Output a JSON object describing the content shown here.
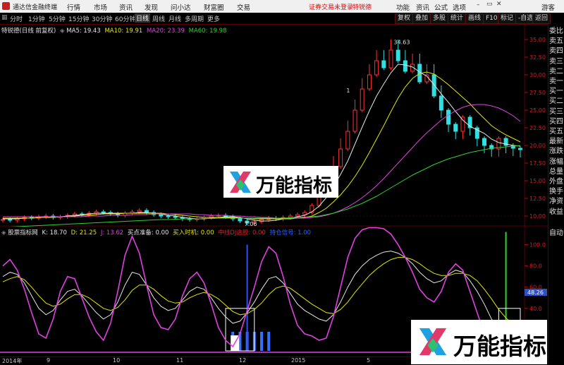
{
  "titlebar": {
    "app_name": "通达信金融终端",
    "menus": [
      "行情",
      "市场",
      "资讯",
      "发现",
      "问小达",
      "财富圈",
      "交易"
    ],
    "notice": "证券交易未登录",
    "tag": "特锐德",
    "buttons": [
      "功能",
      "资讯",
      "公式",
      "选项"
    ],
    "user": "游客",
    "colors": {
      "bg": "#f0f0f0",
      "notice": "#d01010"
    }
  },
  "toolbar": {
    "timeframes": [
      "分时",
      "1分钟",
      "5分钟",
      "15分钟",
      "30分钟",
      "60分钟",
      "日线",
      "周线",
      "月线",
      "多周期",
      "更多"
    ],
    "active_timeframe": "日线",
    "right_buttons": [
      "复权",
      "叠加",
      "多股",
      "统计",
      "画线",
      "F10",
      "标记",
      "-自选",
      "返回"
    ]
  },
  "price_panel": {
    "stock_label": "特锐德(日线 前复权)",
    "ma_legend": [
      {
        "label": "MA5: 19.43",
        "color": "#e6e6e6"
      },
      {
        "label": "MA10: 19.91",
        "color": "#e6e600"
      },
      {
        "label": "MA20: 23.39",
        "color": "#e040e0"
      },
      {
        "label": "MA60: 19.98",
        "color": "#30d030"
      }
    ],
    "y_ticks": [
      "35.00",
      "32.50",
      "30.00",
      "27.50",
      "25.00",
      "22.50",
      "20.00",
      "17.50",
      "15.00",
      "12.50",
      "10.00"
    ],
    "high_label": "34.63",
    "low_label": "7.06",
    "marker_label": "1"
  },
  "indicator_panel": {
    "name_label": "股票指标网",
    "legend": [
      {
        "label": "K: 18.70",
        "color": "#e6e6e6"
      },
      {
        "label": "D: 21.25",
        "color": "#e6e600"
      },
      {
        "label": "J: 13.62",
        "color": "#e040e0"
      },
      {
        "label": "买点准备: 0.00",
        "color": "#e6e6e6"
      },
      {
        "label": "买入时机: 0.00",
        "color": "#e6e600"
      },
      {
        "label": "中线DJ选股: 0.00",
        "color": "#e02020"
      },
      {
        "label": "持仓信号: 1.00",
        "color": "#3060ff"
      }
    ],
    "y_ticks": [
      "100.0",
      "80.0",
      "60.0",
      "40.0",
      "20.0",
      "0.00"
    ],
    "current_value": "48.26"
  },
  "right_column": {
    "items": [
      "委比",
      "卖五",
      "卖四",
      "卖三",
      "卖二",
      "卖一",
      "买一",
      "买二",
      "买三",
      "买四",
      "买五",
      "最新",
      "涨跌",
      "涨幅",
      "总量",
      "外盘",
      "换手",
      "净资",
      "收益"
    ],
    "bottom_item": "自动"
  },
  "x_axis": {
    "labels": [
      "2014年",
      "9",
      "10",
      "11",
      "12",
      "2015",
      "",
      "5"
    ]
  },
  "watermarks": [
    {
      "text": "万能指标"
    },
    {
      "text": "万能指标"
    }
  ],
  "chart_data": [
    {
      "type": "candlestick",
      "title": "特锐德(日线 前复权)",
      "ylim": [
        9.0,
        36.0
      ],
      "y_ticks": [
        35.0,
        32.5,
        30.0,
        27.5,
        25.0,
        22.5,
        20.0,
        17.5,
        15.0,
        12.5,
        10.0
      ],
      "high_annotation": 34.63,
      "low_annotation": 7.06,
      "close_series": [
        9.5,
        9.4,
        9.6,
        9.8,
        9.7,
        9.9,
        10.0,
        9.8,
        9.9,
        10.1,
        10.3,
        10.2,
        10.4,
        10.6,
        10.5,
        10.3,
        10.1,
        10.4,
        10.6,
        10.8,
        10.5,
        10.2,
        10.0,
        9.9,
        9.8,
        9.6,
        9.5,
        9.6,
        9.8,
        10.0,
        10.1,
        9.9,
        9.6,
        9.3,
        9.0,
        9.2,
        9.5,
        9.7,
        9.6,
        9.8,
        10.0,
        10.2,
        10.5,
        11.5,
        13.0,
        14.8,
        17.0,
        19.5,
        22.0,
        25.0,
        28.0,
        30.0,
        32.0,
        31.0,
        33.5,
        32.0,
        30.5,
        31.5,
        29.0,
        30.0,
        27.0,
        25.0,
        23.0,
        22.0,
        24.0,
        22.5,
        21.0,
        20.0,
        19.5,
        21.0,
        20.0,
        19.6,
        19.4
      ],
      "series": [
        {
          "name": "MA5",
          "values": [
            9.6,
            9.6,
            9.6,
            9.7,
            9.7,
            9.8,
            9.8,
            9.8,
            9.9,
            10.0,
            10.1,
            10.2,
            10.3,
            10.4,
            10.4,
            10.4,
            10.4,
            10.4,
            10.4,
            10.5,
            10.5,
            10.4,
            10.3,
            10.1,
            10.0,
            9.8,
            9.7,
            9.6,
            9.6,
            9.7,
            9.8,
            9.9,
            9.9,
            9.8,
            9.6,
            9.4,
            9.3,
            9.3,
            9.4,
            9.6,
            9.7,
            9.9,
            10.1,
            10.6,
            11.4,
            12.6,
            14.1,
            15.9,
            17.8,
            20.2,
            22.6,
            24.9,
            27.0,
            28.7,
            30.3,
            31.5,
            31.4,
            31.1,
            30.4,
            29.8,
            28.6,
            27.3,
            26.1,
            24.8,
            23.6,
            22.7,
            22.2,
            21.7,
            20.9,
            20.4,
            20.2,
            20.0,
            19.9
          ]
        },
        {
          "name": "MA10",
          "values": [
            9.7,
            9.7,
            9.7,
            9.7,
            9.7,
            9.8,
            9.8,
            9.8,
            9.9,
            9.9,
            10.0,
            10.1,
            10.1,
            10.2,
            10.3,
            10.3,
            10.3,
            10.4,
            10.4,
            10.4,
            10.4,
            10.4,
            10.4,
            10.3,
            10.2,
            10.1,
            10.0,
            9.9,
            9.8,
            9.8,
            9.8,
            9.8,
            9.8,
            9.7,
            9.7,
            9.6,
            9.6,
            9.6,
            9.6,
            9.6,
            9.6,
            9.7,
            9.8,
            10.0,
            10.5,
            11.1,
            12.0,
            13.0,
            14.2,
            15.6,
            17.2,
            19.0,
            20.9,
            22.8,
            24.8,
            26.7,
            28.3,
            29.5,
            30.2,
            30.4,
            30.1,
            29.4,
            28.6,
            27.7,
            26.8,
            25.9,
            24.8,
            23.8,
            22.8,
            22.1,
            21.5,
            21.0,
            20.5
          ]
        },
        {
          "name": "MA20",
          "values": [
            9.9,
            9.9,
            9.9,
            9.9,
            9.9,
            9.9,
            9.9,
            9.9,
            9.9,
            9.9,
            9.9,
            9.9,
            10.0,
            10.0,
            10.0,
            10.1,
            10.1,
            10.1,
            10.2,
            10.2,
            10.2,
            10.3,
            10.3,
            10.3,
            10.3,
            10.3,
            10.3,
            10.2,
            10.2,
            10.1,
            10.1,
            10.1,
            10.0,
            10.0,
            9.9,
            9.9,
            9.8,
            9.8,
            9.7,
            9.7,
            9.7,
            9.7,
            9.7,
            9.8,
            9.9,
            10.1,
            10.4,
            10.8,
            11.3,
            11.9,
            12.6,
            13.4,
            14.3,
            15.3,
            16.4,
            17.5,
            18.6,
            19.7,
            20.8,
            21.8,
            22.7,
            23.6,
            24.3,
            24.9,
            25.4,
            25.7,
            25.8,
            25.8,
            25.6,
            25.3,
            24.8,
            24.2,
            23.4
          ]
        },
        {
          "name": "MA60",
          "values": [
            8.4,
            8.45,
            8.5,
            8.55,
            8.6,
            8.65,
            8.7,
            8.75,
            8.8,
            8.85,
            8.9,
            8.95,
            9.0,
            9.05,
            9.1,
            9.15,
            9.2,
            9.25,
            9.3,
            9.35,
            9.4,
            9.45,
            9.5,
            9.5,
            9.55,
            9.6,
            9.6,
            9.6,
            9.65,
            9.65,
            9.7,
            9.7,
            9.7,
            9.7,
            9.7,
            9.7,
            9.7,
            9.7,
            9.7,
            9.7,
            9.75,
            9.8,
            9.85,
            9.9,
            10.0,
            10.2,
            10.4,
            10.7,
            11.0,
            11.4,
            11.8,
            12.3,
            12.8,
            13.4,
            14.0,
            14.6,
            15.2,
            15.8,
            16.3,
            16.8,
            17.3,
            17.7,
            18.1,
            18.4,
            18.7,
            19.0,
            19.2,
            19.4,
            19.6,
            19.7,
            19.8,
            19.9,
            19.98
          ]
        }
      ]
    },
    {
      "type": "line",
      "title": "股票指标网",
      "ylim": [
        0,
        105
      ],
      "y_ticks": [
        100,
        80,
        60,
        40,
        20,
        0
      ],
      "series": [
        {
          "name": "K",
          "values": [
            70,
            74,
            72,
            64,
            52,
            40,
            34,
            38,
            48,
            56,
            58,
            52,
            44,
            36,
            30,
            34,
            46,
            62,
            74,
            72,
            62,
            50,
            42,
            38,
            40,
            48,
            56,
            60,
            58,
            50,
            40,
            32,
            26,
            28,
            36,
            46,
            58,
            68,
            70,
            64,
            54,
            44,
            38,
            34,
            30,
            28,
            34,
            46,
            60,
            72,
            80,
            86,
            90,
            93,
            94,
            92,
            88,
            82,
            74,
            68,
            64,
            66,
            72,
            76,
            74,
            66,
            56,
            44,
            30,
            20,
            16,
            18,
            18.7
          ]
        },
        {
          "name": "D",
          "values": [
            65,
            68,
            70,
            67,
            60,
            52,
            45,
            42,
            44,
            49,
            53,
            53,
            50,
            45,
            40,
            38,
            41,
            48,
            57,
            62,
            62,
            58,
            52,
            47,
            45,
            46,
            50,
            53,
            55,
            53,
            49,
            43,
            37,
            34,
            35,
            39,
            45,
            53,
            59,
            61,
            59,
            54,
            49,
            44,
            40,
            36,
            35,
            39,
            46,
            55,
            63,
            71,
            77,
            82,
            86,
            88,
            88,
            86,
            82,
            77,
            73,
            71,
            71,
            73,
            73,
            71,
            66,
            58,
            49,
            39,
            31,
            25,
            21.25
          ]
        },
        {
          "name": "J",
          "values": [
            80,
            86,
            76,
            58,
            36,
            16,
            12,
            30,
            56,
            70,
            68,
            50,
            32,
            18,
            10,
            26,
            56,
            90,
            108,
            92,
            62,
            34,
            22,
            20,
            30,
            52,
            68,
            74,
            64,
            44,
            22,
            10,
            4,
            16,
            38,
            60,
            84,
            98,
            92,
            70,
            44,
            24,
            16,
            14,
            10,
            12,
            32,
            60,
            88,
            106,
            114,
            116,
            116,
            115,
            110,
            100,
            88,
            74,
            58,
            50,
            46,
            56,
            74,
            82,
            76,
            56,
            36,
            16,
            0,
            0,
            0,
            4,
            13.62
          ]
        },
        {
          "name": "持仓信号",
          "values": [
            0,
            0,
            0,
            0,
            0,
            0,
            0,
            0,
            0,
            0,
            0,
            0,
            0,
            0,
            0,
            0,
            0,
            0,
            0,
            0,
            0,
            0,
            0,
            0,
            0,
            0,
            0,
            0,
            0,
            0,
            0,
            0,
            1,
            1,
            1,
            1,
            1,
            1,
            0,
            0,
            0,
            0,
            0,
            0,
            0,
            0,
            0,
            0,
            0,
            0,
            0,
            0,
            0,
            0,
            0,
            0,
            0,
            0,
            0,
            0,
            0,
            0,
            0,
            0,
            0,
            0,
            0,
            0,
            0,
            0,
            1,
            1,
            1
          ]
        }
      ]
    }
  ]
}
